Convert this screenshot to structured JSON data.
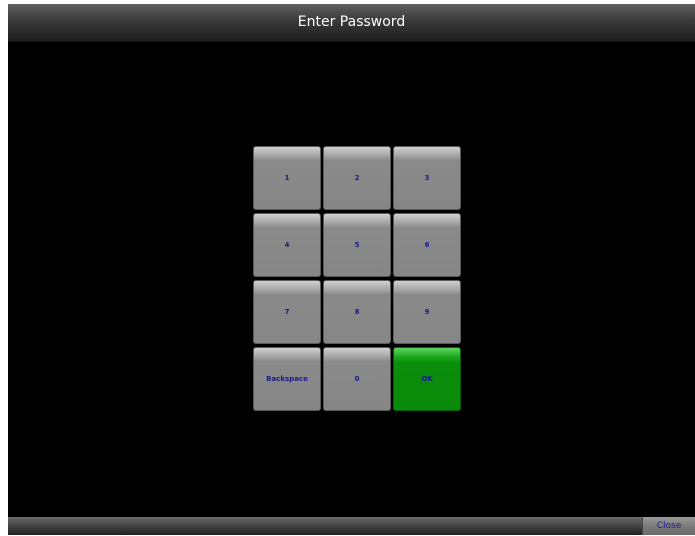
{
  "window": {
    "title": "Enter Password"
  },
  "keypad": {
    "keys": [
      "1",
      "2",
      "3",
      "4",
      "5",
      "6",
      "7",
      "8",
      "9",
      "Backspace",
      "0",
      "OK"
    ]
  },
  "footer": {
    "close_label": "Close"
  },
  "colors": {
    "background": "#000000",
    "key_gray": "#868686",
    "ok_green": "#0a8a0a",
    "key_text": "#1a1a8a"
  }
}
